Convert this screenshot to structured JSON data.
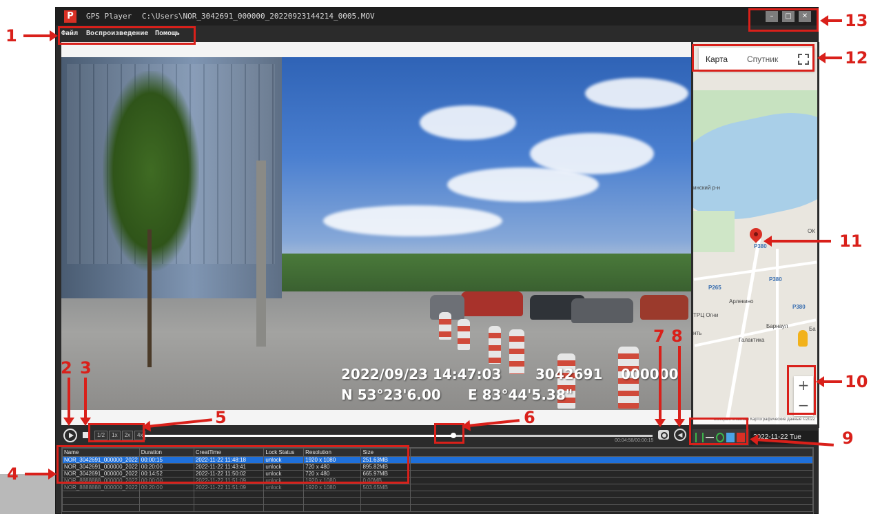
{
  "window": {
    "app_name": "GPS Player",
    "file_path": "C:\\Users\\NOR_3042691_000000_20220923144214_0005.MOV",
    "minimize_glyph": "–",
    "maximize_glyph": "□",
    "close_glyph": "✕"
  },
  "menu": {
    "file": "Файл",
    "playback": "Воспроизведение",
    "help": "Помощь"
  },
  "osd": {
    "datetime": "2022/09/23 14:47:03",
    "device_id": "3042691",
    "extra_code": "000000",
    "latitude": "N  53°23'6.00",
    "longitude": "E  83°44'5.38\""
  },
  "controls": {
    "speeds": [
      "1/2",
      "1x",
      "2x",
      "4x"
    ],
    "timecode": "00:04:58/00:00:15",
    "seek_progress": 0.61,
    "volume_glyph": "◀"
  },
  "map": {
    "tab_map": "Карта",
    "tab_satellite": "Спутник",
    "labels": [
      "инский р-н",
      "P380",
      "P380",
      "P265",
      "Арлекино",
      "P380",
      "ТРЦ Огни",
      "Барнаул",
      "Ба",
      "Галактика",
      "нть",
      "ОК"
    ],
    "zoom_in": "+",
    "zoom_out": "−",
    "footer": "Быстрые клавиши   Картографические данные ©2022"
  },
  "map_tools": [
    "crosshair-icon",
    "line-icon",
    "circle-icon",
    "save-icon",
    "delete-icon"
  ],
  "date_display": "2022-11-22 Tue",
  "file_table": {
    "columns": [
      "Name",
      "Duration",
      "CreatTime",
      "Lock Status",
      "Resolution",
      "Size"
    ],
    "rows": [
      [
        "NOR_3042691_000000_2022",
        "00:00:15",
        "2022-11-22 11:48:18",
        "unlock",
        "1920 x 1080",
        "251.63MB"
      ],
      [
        "NOR_3042691_000000_2022",
        "00:20:00",
        "2022-11-22 11:43:41",
        "unlock",
        "720 x 480",
        "895.82MB"
      ],
      [
        "NOR_3042691_000000_2022",
        "00:14:52",
        "2022-11-22 11:50:02",
        "unlock",
        "720 x 480",
        "665.97MB"
      ],
      [
        "NOR_8888888_000000_2022",
        "00:00:00",
        "2022-11-22 11:51:09",
        "unlock",
        "1920 x 1080",
        "0.00MB"
      ],
      [
        "NOR_8888888_000000_2022",
        "00:20:00",
        "2022-11-22 11:51:09",
        "unlock",
        "1920 x 1080",
        "503.65MB"
      ]
    ]
  },
  "annotations": {
    "n1": "1",
    "n2": "2",
    "n3": "3",
    "n4": "4",
    "n5": "5",
    "n6": "6",
    "n7": "7",
    "n8": "8",
    "n9": "9",
    "n10": "10",
    "n11": "11",
    "n12": "12",
    "n13": "13"
  }
}
